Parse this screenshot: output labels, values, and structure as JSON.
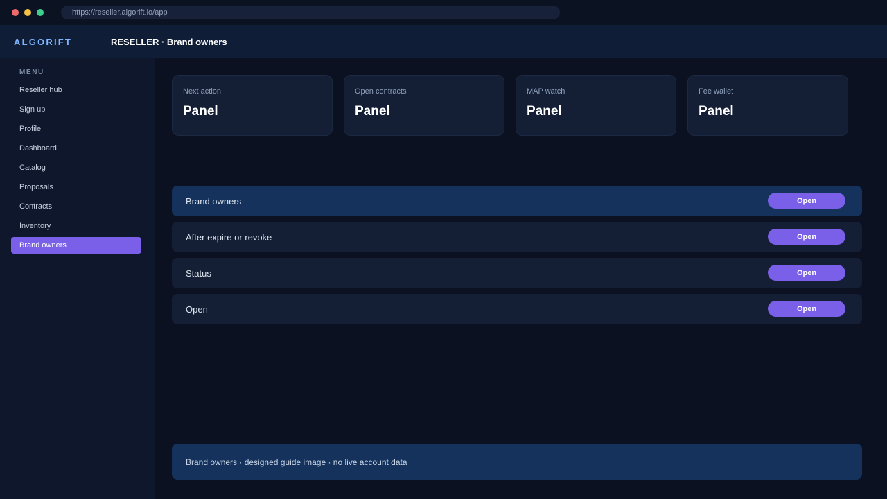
{
  "browser": {
    "url": "https://reseller.algorift.io/app"
  },
  "header": {
    "brand": "ALGORIFT",
    "title": "RESELLER · Brand owners"
  },
  "sidebar": {
    "heading": "MENU",
    "items": [
      {
        "label": "Reseller hub"
      },
      {
        "label": "Sign up"
      },
      {
        "label": "Profile"
      },
      {
        "label": "Dashboard"
      },
      {
        "label": "Catalog"
      },
      {
        "label": "Proposals"
      },
      {
        "label": "Contracts"
      },
      {
        "label": "Inventory"
      },
      {
        "label": "Brand owners"
      }
    ]
  },
  "cards": [
    {
      "label": "Next action",
      "value": "Panel"
    },
    {
      "label": "Open contracts",
      "value": "Panel"
    },
    {
      "label": "MAP watch",
      "value": "Panel"
    },
    {
      "label": "Fee wallet",
      "value": "Panel"
    }
  ],
  "rows": [
    {
      "label": "Brand owners",
      "button": "Open"
    },
    {
      "label": "After expire or revoke",
      "button": "Open"
    },
    {
      "label": "Status",
      "button": "Open"
    },
    {
      "label": "Open",
      "button": "Open"
    }
  ],
  "footer": {
    "note": "Brand owners · designed guide image · no live account data"
  },
  "colors": {
    "accent": "#7a60e8",
    "highlight": "#14325c",
    "background": "#0b1120",
    "brand": "#7fb4ff"
  }
}
